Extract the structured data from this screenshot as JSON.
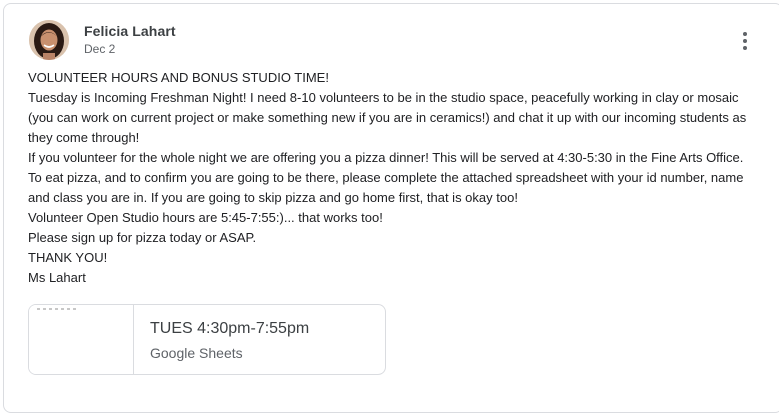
{
  "post": {
    "author": "Felicia Lahart",
    "date": "Dec 2",
    "more_icon": "more-vert-icon",
    "body_lines": [
      "VOLUNTEER HOURS AND BONUS STUDIO TIME!",
      "Tuesday is Incoming Freshman Night!  I need 8-10 volunteers to be in the studio space, peacefully working in clay or mosaic (you can work on current project or make something new if you are in ceramics!) and chat it up with our incoming students as they come through!",
      "If you volunteer for the whole night we are offering you a pizza dinner!  This will be served at 4:30-5:30 in the Fine Arts Office.  To eat pizza, and to confirm you are going to be there, please complete the attached spreadsheet with your id number, name and class you are in.  If you are going to skip pizza and go home first, that is okay too!",
      "Volunteer Open Studio hours are 5:45-7:55:)... that works too!",
      "Please sign up for pizza today or ASAP.",
      "THANK YOU!",
      "Ms Lahart"
    ]
  },
  "attachment": {
    "title": "TUES 4:30pm-7:55pm",
    "type": "Google Sheets"
  }
}
